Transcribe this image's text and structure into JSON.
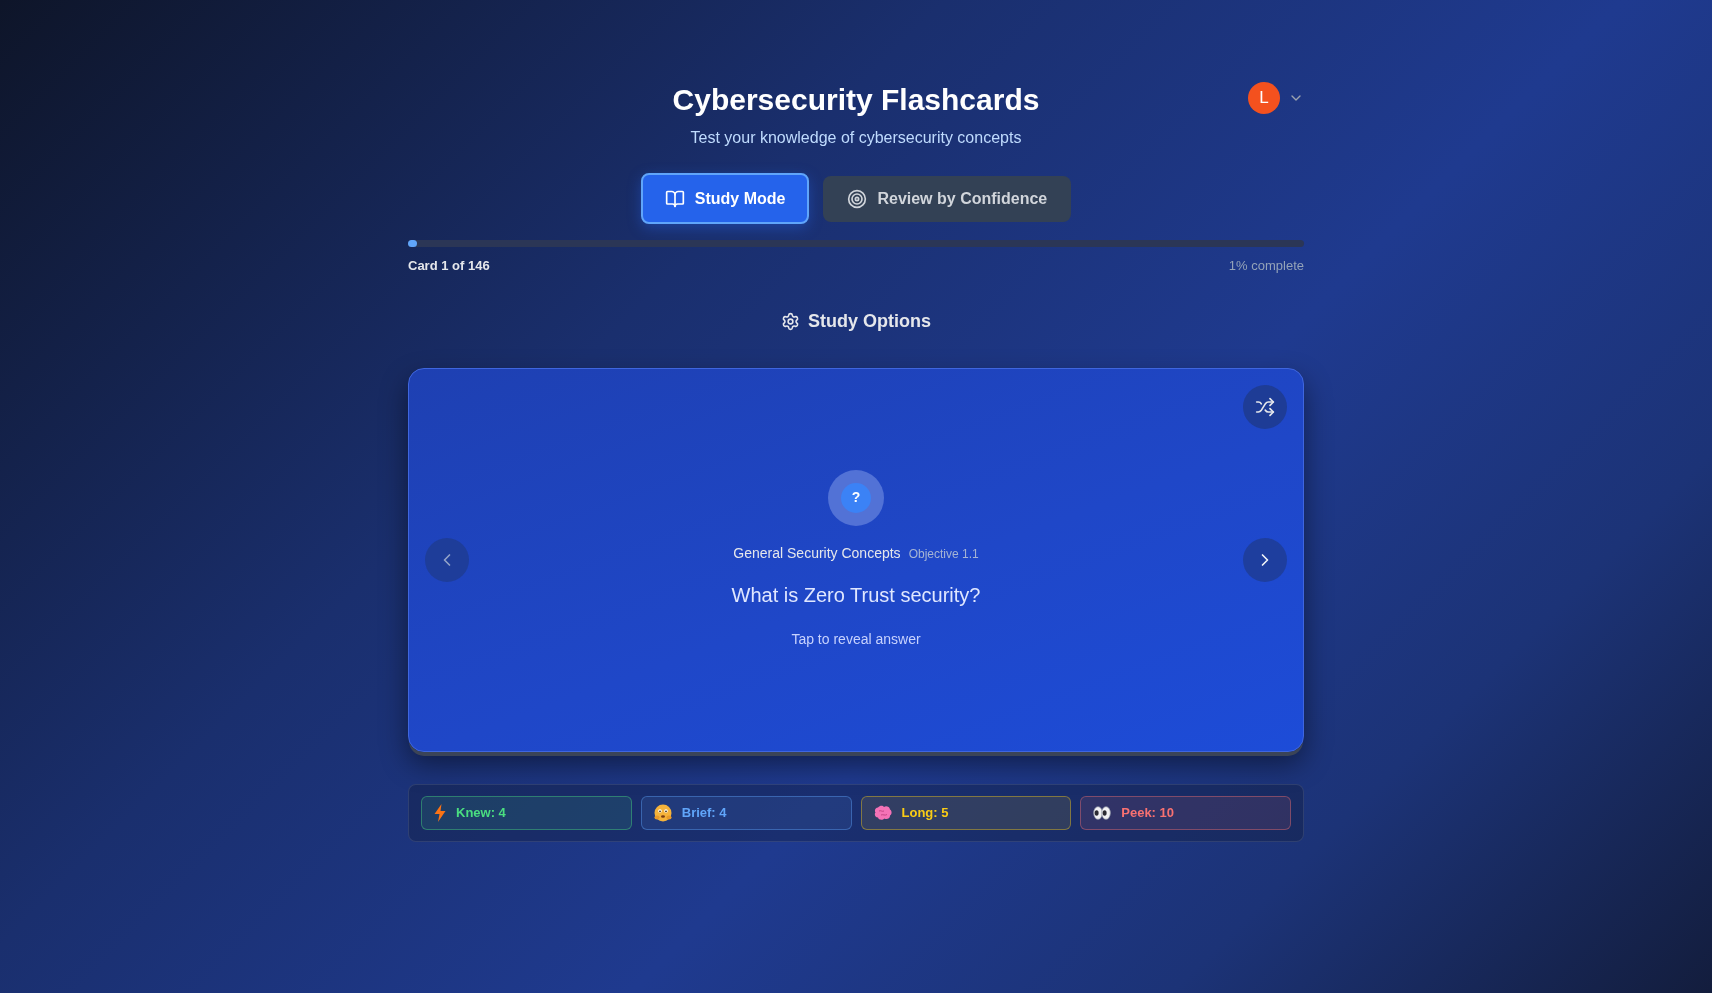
{
  "header": {
    "title": "Cybersecurity Flashcards",
    "subtitle": "Test your knowledge of cybersecurity concepts",
    "avatar": {
      "initial": "L"
    }
  },
  "tabs": [
    {
      "label": "Study Mode",
      "selected": true
    },
    {
      "label": "Review by Confidence",
      "selected": false
    }
  ],
  "progress": {
    "level": 0.01,
    "card_label": "Card 1 of 146",
    "percent_label": "1% complete"
  },
  "study_options": {
    "label": "Study Options"
  },
  "card": {
    "icon_glyph": "?",
    "category": "General Security Concepts",
    "objective": "Objective 1.1",
    "question": "What is Zero Trust security?",
    "hint": "Tap to reveal answer"
  },
  "stats": [
    {
      "label": "Knew: 4",
      "color": "#4ade80"
    },
    {
      "label": "Brief: 4",
      "color": "#60a5fa"
    },
    {
      "label": "Long: 5",
      "color": "#facc15"
    },
    {
      "label": "Peek: 10",
      "color": "#f87171"
    }
  ]
}
